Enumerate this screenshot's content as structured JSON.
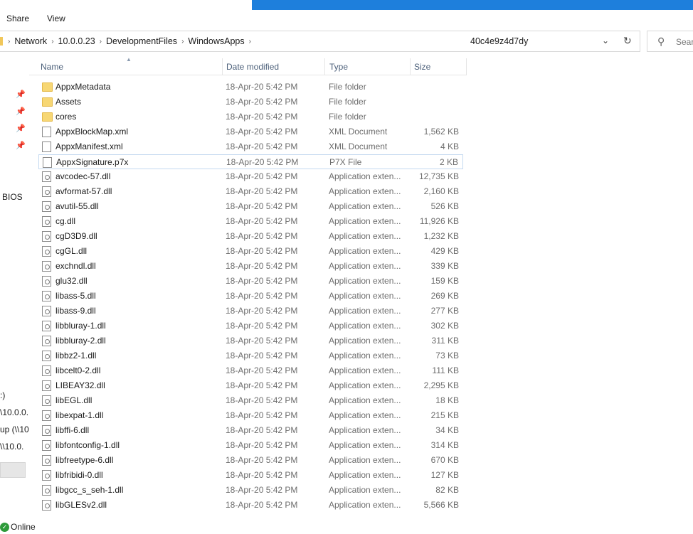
{
  "ribbon": {
    "tabs": [
      "Share",
      "View"
    ]
  },
  "address": {
    "crumbs": [
      "Network",
      "10.0.0.23",
      "DevelopmentFiles",
      "WindowsApps"
    ],
    "overflow_text": "40c4e9z4d7dy",
    "dropdown_icon": "chevron-down-icon",
    "refresh_icon": "refresh-icon"
  },
  "search": {
    "placeholder": "Sear"
  },
  "nav": {
    "pins": 4,
    "items": [
      "BIOS",
      ":)",
      "\\10.0.0.",
      "up (\\\\10",
      "\\\\10.0."
    ]
  },
  "columns": {
    "name": "Name",
    "date": "Date modified",
    "type": "Type",
    "size": "Size"
  },
  "files": [
    {
      "name": "AppxMetadata",
      "date": "18-Apr-20 5:42 PM",
      "type": "File folder",
      "size": "",
      "icon": "folder"
    },
    {
      "name": "Assets",
      "date": "18-Apr-20 5:42 PM",
      "type": "File folder",
      "size": "",
      "icon": "folder"
    },
    {
      "name": "cores",
      "date": "18-Apr-20 5:42 PM",
      "type": "File folder",
      "size": "",
      "icon": "folder"
    },
    {
      "name": "AppxBlockMap.xml",
      "date": "18-Apr-20 5:42 PM",
      "type": "XML Document",
      "size": "1,562 KB",
      "icon": "doc"
    },
    {
      "name": "AppxManifest.xml",
      "date": "18-Apr-20 5:42 PM",
      "type": "XML Document",
      "size": "4 KB",
      "icon": "doc"
    },
    {
      "name": "AppxSignature.p7x",
      "date": "18-Apr-20 5:42 PM",
      "type": "P7X File",
      "size": "2 KB",
      "icon": "doc",
      "selected": true
    },
    {
      "name": "avcodec-57.dll",
      "date": "18-Apr-20 5:42 PM",
      "type": "Application exten...",
      "size": "12,735 KB",
      "icon": "dll"
    },
    {
      "name": "avformat-57.dll",
      "date": "18-Apr-20 5:42 PM",
      "type": "Application exten...",
      "size": "2,160 KB",
      "icon": "dll"
    },
    {
      "name": "avutil-55.dll",
      "date": "18-Apr-20 5:42 PM",
      "type": "Application exten...",
      "size": "526 KB",
      "icon": "dll"
    },
    {
      "name": "cg.dll",
      "date": "18-Apr-20 5:42 PM",
      "type": "Application exten...",
      "size": "11,926 KB",
      "icon": "dll"
    },
    {
      "name": "cgD3D9.dll",
      "date": "18-Apr-20 5:42 PM",
      "type": "Application exten...",
      "size": "1,232 KB",
      "icon": "dll"
    },
    {
      "name": "cgGL.dll",
      "date": "18-Apr-20 5:42 PM",
      "type": "Application exten...",
      "size": "429 KB",
      "icon": "dll"
    },
    {
      "name": "exchndl.dll",
      "date": "18-Apr-20 5:42 PM",
      "type": "Application exten...",
      "size": "339 KB",
      "icon": "dll"
    },
    {
      "name": "glu32.dll",
      "date": "18-Apr-20 5:42 PM",
      "type": "Application exten...",
      "size": "159 KB",
      "icon": "dll"
    },
    {
      "name": "libass-5.dll",
      "date": "18-Apr-20 5:42 PM",
      "type": "Application exten...",
      "size": "269 KB",
      "icon": "dll"
    },
    {
      "name": "libass-9.dll",
      "date": "18-Apr-20 5:42 PM",
      "type": "Application exten...",
      "size": "277 KB",
      "icon": "dll"
    },
    {
      "name": "libbluray-1.dll",
      "date": "18-Apr-20 5:42 PM",
      "type": "Application exten...",
      "size": "302 KB",
      "icon": "dll"
    },
    {
      "name": "libbluray-2.dll",
      "date": "18-Apr-20 5:42 PM",
      "type": "Application exten...",
      "size": "311 KB",
      "icon": "dll"
    },
    {
      "name": "libbz2-1.dll",
      "date": "18-Apr-20 5:42 PM",
      "type": "Application exten...",
      "size": "73 KB",
      "icon": "dll"
    },
    {
      "name": "libcelt0-2.dll",
      "date": "18-Apr-20 5:42 PM",
      "type": "Application exten...",
      "size": "111 KB",
      "icon": "dll"
    },
    {
      "name": "LIBEAY32.dll",
      "date": "18-Apr-20 5:42 PM",
      "type": "Application exten...",
      "size": "2,295 KB",
      "icon": "dll"
    },
    {
      "name": "libEGL.dll",
      "date": "18-Apr-20 5:42 PM",
      "type": "Application exten...",
      "size": "18 KB",
      "icon": "dll"
    },
    {
      "name": "libexpat-1.dll",
      "date": "18-Apr-20 5:42 PM",
      "type": "Application exten...",
      "size": "215 KB",
      "icon": "dll"
    },
    {
      "name": "libffi-6.dll",
      "date": "18-Apr-20 5:42 PM",
      "type": "Application exten...",
      "size": "34 KB",
      "icon": "dll"
    },
    {
      "name": "libfontconfig-1.dll",
      "date": "18-Apr-20 5:42 PM",
      "type": "Application exten...",
      "size": "314 KB",
      "icon": "dll"
    },
    {
      "name": "libfreetype-6.dll",
      "date": "18-Apr-20 5:42 PM",
      "type": "Application exten...",
      "size": "670 KB",
      "icon": "dll"
    },
    {
      "name": "libfribidi-0.dll",
      "date": "18-Apr-20 5:42 PM",
      "type": "Application exten...",
      "size": "127 KB",
      "icon": "dll"
    },
    {
      "name": "libgcc_s_seh-1.dll",
      "date": "18-Apr-20 5:42 PM",
      "type": "Application exten...",
      "size": "82 KB",
      "icon": "dll"
    },
    {
      "name": "libGLESv2.dll",
      "date": "18-Apr-20 5:42 PM",
      "type": "Application exten...",
      "size": "5,566 KB",
      "icon": "dll"
    }
  ],
  "status": {
    "label": "Online"
  },
  "colors": {
    "accent": "#1e7fdc",
    "folder": "#f7d774",
    "header_text": "#4c607a",
    "online": "#2e9b3a"
  }
}
